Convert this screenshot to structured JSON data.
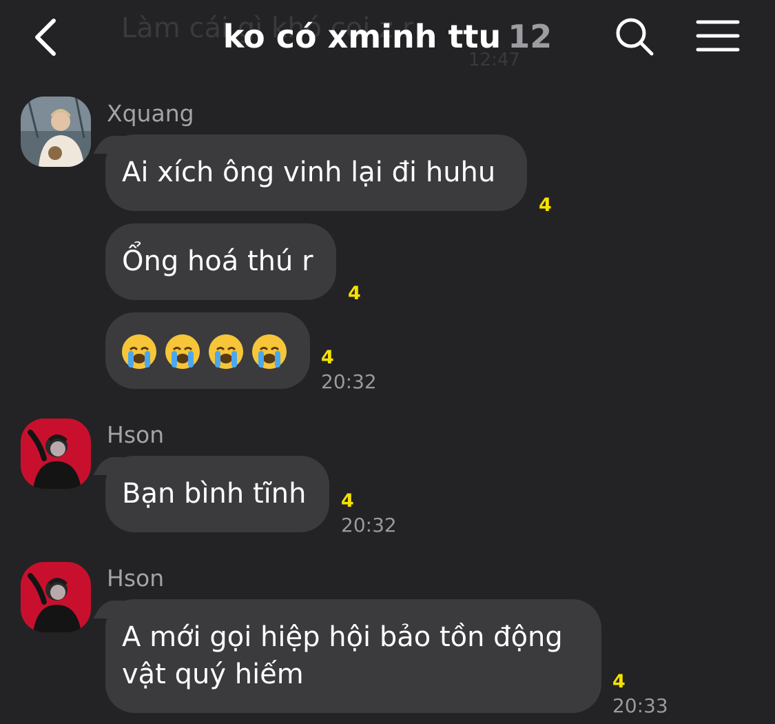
{
  "header": {
    "title": "ko có xminh ttu",
    "member_count": "12",
    "back_icon": "chevron-left-icon",
    "search_icon": "search-icon",
    "menu_icon": "hamburger-menu-icon"
  },
  "background_preview": {
    "text": "Làm cái gì khó coi z r",
    "time": "12:47"
  },
  "messages": [
    {
      "sender": "Xquang",
      "avatar": "avatar-xquang",
      "bubbles": [
        {
          "text": "Ai xích ông vinh lại đi huhu",
          "read": "4",
          "time": ""
        },
        {
          "text": "Ổng hoá thú r",
          "read": "4",
          "time": ""
        },
        {
          "text": "😭😭😭😭",
          "read": "4",
          "time": "20:32"
        }
      ]
    },
    {
      "sender": "Hson",
      "avatar": "avatar-hson",
      "bubbles": [
        {
          "text": "Bạn bình tĩnh",
          "read": "4",
          "time": "20:32"
        }
      ]
    },
    {
      "sender": "Hson",
      "avatar": "avatar-hson",
      "bubbles": [
        {
          "text": "A mới gọi hiệp hội bảo tồn động vật quý hiếm",
          "read": "4",
          "time": "20:33"
        }
      ]
    }
  ],
  "colors": {
    "background": "#232325",
    "bubble": "#3b3b3e",
    "read_count": "#f6e100",
    "timestamp": "#9a9a9e",
    "sender_name": "#a4a4a8"
  }
}
